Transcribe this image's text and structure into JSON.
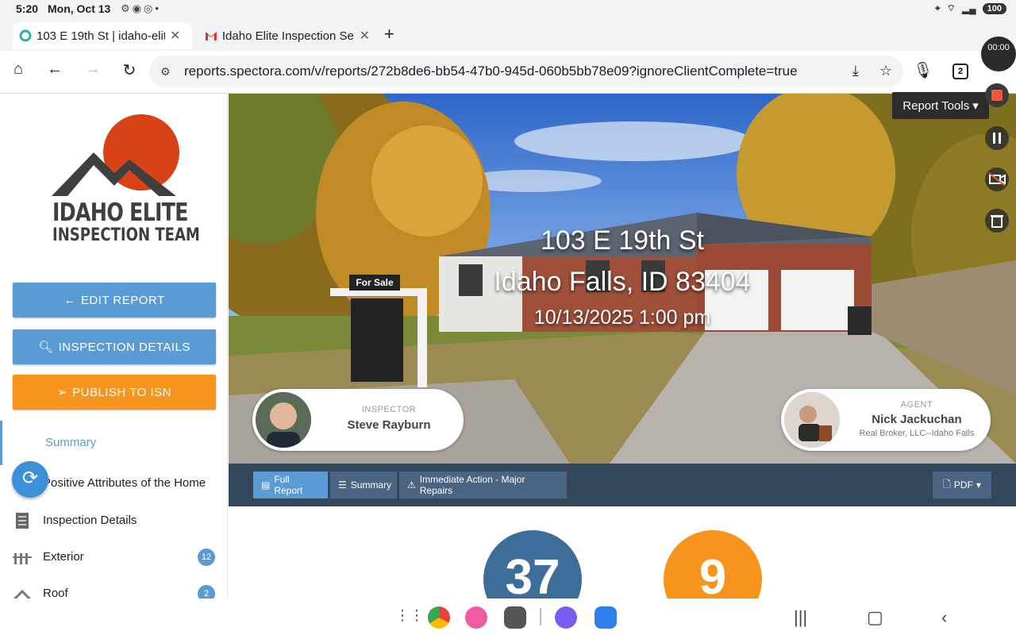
{
  "status_bar": {
    "time": "5:20",
    "date": "Mon, Oct 13",
    "battery": "100"
  },
  "tabs": [
    {
      "title": "103 E 19th St | idaho-elite",
      "active": true
    },
    {
      "title": "Idaho Elite Inspection Se",
      "active": false
    }
  ],
  "address_bar": {
    "url": "reports.spectora.com/v/reports/272b8de6-bb54-47b0-945d-060b5bb78e09?ignoreClientComplete=true",
    "tab_count": "2"
  },
  "sidebar": {
    "logo_line1": "IDAHO ELITE",
    "logo_line2": "INSPECTION TEAM",
    "buttons": {
      "edit": "EDIT REPORT",
      "details": "INSPECTION DETAILS",
      "publish": "PUBLISH TO ISN"
    },
    "summary_label": "Summary",
    "items": [
      {
        "label": "Positive Attributes of the Home",
        "icon": "home-icon",
        "badge": ""
      },
      {
        "label": "Inspection Details",
        "icon": "document-icon",
        "badge": ""
      },
      {
        "label": "Exterior",
        "icon": "fence-icon",
        "badge": "12"
      },
      {
        "label": "Roof",
        "icon": "roof-icon",
        "badge": "2"
      }
    ]
  },
  "hero": {
    "address_line1": "103 E 19th St",
    "address_line2": "Idaho Falls, ID 83404",
    "datetime": "10/13/2025 1:00 pm",
    "sign_text": "For Sale",
    "inspector": {
      "role": "INSPECTOR",
      "name": "Steve Rayburn"
    },
    "agent": {
      "role": "AGENT",
      "name": "Nick Jackuchan",
      "company": "Real Broker, LLC--Idaho Falls"
    }
  },
  "report_toolbar": {
    "tabs": [
      "Full Report",
      "Summary",
      "Immediate Action - Major Repairs"
    ],
    "pdf_label": "PDF"
  },
  "report_tools_label": "Report Tools",
  "recorder": {
    "timer": "00:00"
  },
  "stats": {
    "total": "37",
    "second": "9"
  },
  "colors": {
    "accent_blue": "#5b9bd5",
    "publish_orange": "#f7941d",
    "toolbar_dark": "#33485d",
    "circle_blue": "#3d6e99",
    "circle_orange": "#f7941d"
  }
}
